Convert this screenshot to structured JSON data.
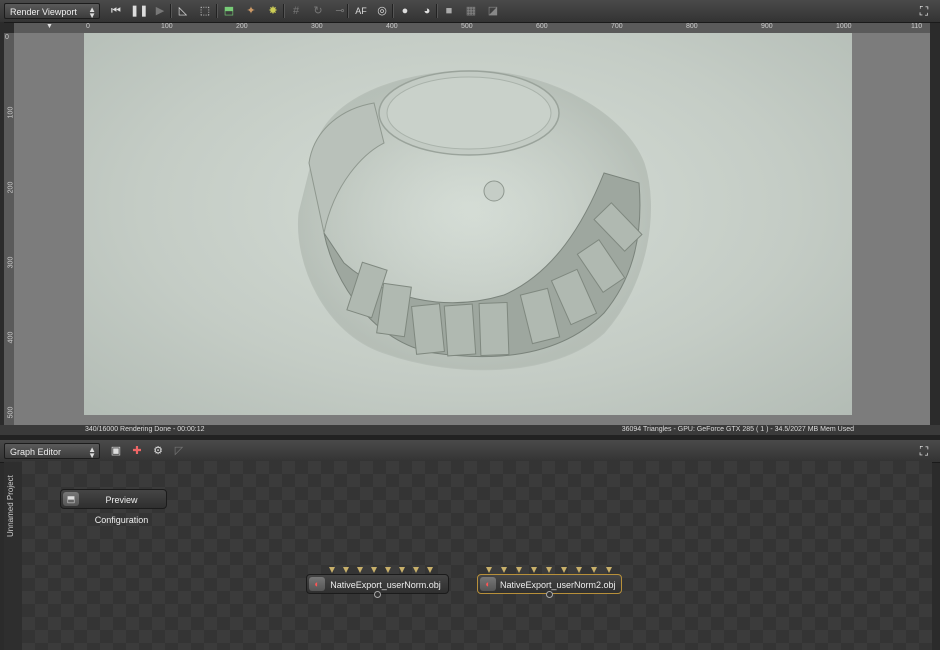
{
  "viewport": {
    "panel_title": "Render Viewport",
    "ruler_top_ticks": [
      "0",
      "100",
      "200",
      "300",
      "400",
      "500",
      "600",
      "700",
      "800",
      "900",
      "1000",
      "110"
    ],
    "ruler_left_ticks": [
      "0",
      "100",
      "200",
      "300",
      "400",
      "500"
    ],
    "status_left": "340/16000 Rendering Done - 00:00:12",
    "status_right": "36094 Triangles - GPU: GeForce GTX 285 ( 1 ) - 34.5/2027 MB Mem Used",
    "toolbar_af_label": "AF"
  },
  "graph_editor": {
    "panel_title": "Graph Editor",
    "side_tab": "Unnamed Project",
    "nodes": {
      "preview": "Preview Configuration",
      "export1": "NativeExport_userNorm.obj",
      "export2": "NativeExport_userNorm2.obj"
    }
  },
  "icons": {
    "skip_start": "skip-to-start-icon",
    "pause": "pause-icon",
    "play": "play-icon",
    "maximize": "maximize-icon"
  },
  "colors": {
    "selected_node_border": "#b8903a",
    "pin_color": "#c8b06a"
  }
}
